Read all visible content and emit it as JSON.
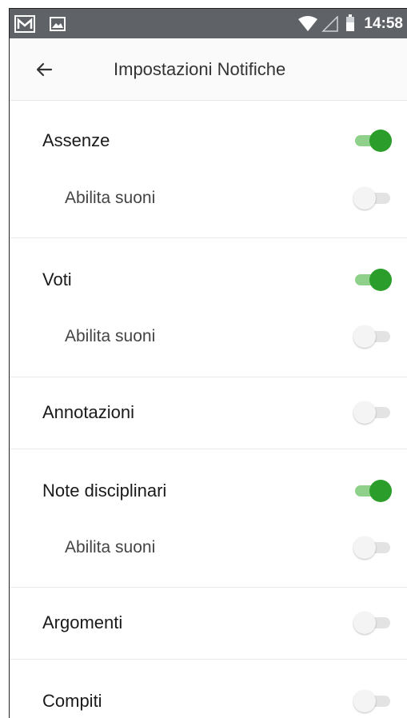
{
  "status_bar": {
    "time": "14:58",
    "icons": [
      "gmail-icon",
      "image-icon",
      "wifi-icon",
      "signal-icon",
      "battery-icon"
    ]
  },
  "app_bar": {
    "title": "Impostazioni Notifiche",
    "back_icon": "arrow-left-icon"
  },
  "sections": [
    {
      "label": "Assenze",
      "enabled": true,
      "sub": {
        "label": "Abilita suoni",
        "enabled": false
      }
    },
    {
      "label": "Voti",
      "enabled": true,
      "sub": {
        "label": "Abilita suoni",
        "enabled": false
      }
    },
    {
      "label": "Annotazioni",
      "enabled": false
    },
    {
      "label": "Note disciplinari",
      "enabled": true,
      "sub": {
        "label": "Abilita suoni",
        "enabled": false
      }
    },
    {
      "label": "Argomenti",
      "enabled": false
    },
    {
      "label": "Compiti",
      "enabled": false
    }
  ],
  "colors": {
    "status_bar": "#5f6368",
    "toggle_on_knob": "#2a9d2a",
    "toggle_on_track": "#8fd08a",
    "toggle_off_knob": "#f4f4f4",
    "toggle_off_track": "#e3e3e3"
  }
}
